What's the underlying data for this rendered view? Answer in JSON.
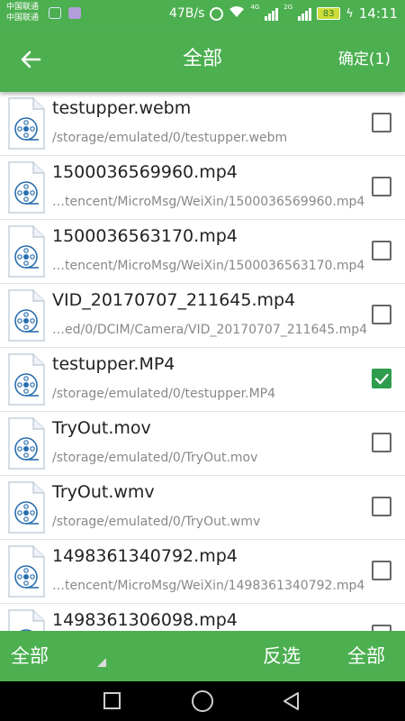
{
  "status_bar": {
    "carrier_1": "中国联通",
    "carrier_2": "中国联通",
    "net_speed": "47B/s",
    "network_gen": "4G",
    "network_gen_2": "2G",
    "battery": "83",
    "time": "14:11",
    "icons": [
      "photo-app-icon",
      "purple-app-icon",
      "alarm-icon",
      "wifi-icon",
      "signal-icon",
      "battery-icon"
    ]
  },
  "toolbar": {
    "title": "全部",
    "confirm_label": "确定(1)",
    "back_icon": "back-arrow-icon"
  },
  "files": [
    {
      "name": "testupper.webm",
      "path": "/storage/emulated/0/testupper.webm",
      "checked": false
    },
    {
      "name": "1500036569960.mp4",
      "path": "…tencent/MicroMsg/WeiXin/1500036569960.mp4",
      "checked": false
    },
    {
      "name": "1500036563170.mp4",
      "path": "…tencent/MicroMsg/WeiXin/1500036563170.mp4",
      "checked": false
    },
    {
      "name": "VID_20170707_211645.mp4",
      "path": "…ed/0/DCIM/Camera/VID_20170707_211645.mp4",
      "checked": false
    },
    {
      "name": "testupper.MP4",
      "path": "/storage/emulated/0/testupper.MP4",
      "checked": true
    },
    {
      "name": "TryOut.mov",
      "path": "/storage/emulated/0/TryOut.mov",
      "checked": false
    },
    {
      "name": "TryOut.wmv",
      "path": "/storage/emulated/0/TryOut.wmv",
      "checked": false
    },
    {
      "name": "1498361340792.mp4",
      "path": "…tencent/MicroMsg/WeiXin/1498361340792.mp4",
      "checked": false
    },
    {
      "name": "1498361306098.mp4",
      "path": "",
      "checked": false
    }
  ],
  "bottom_bar": {
    "filter_label": "全部",
    "invert_label": "反选",
    "select_all_label": "全部"
  },
  "nav_bar": {
    "icons": [
      "recent-apps-icon",
      "home-icon",
      "back-icon"
    ]
  },
  "colors": {
    "accent": "#4caf50",
    "checked": "#2e9c4d",
    "nav_bg": "#000000"
  }
}
